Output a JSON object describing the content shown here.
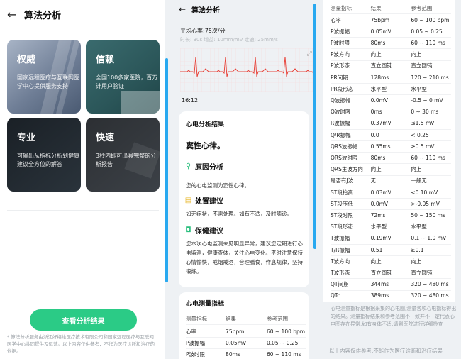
{
  "panel1": {
    "title": "算法分析",
    "cards": [
      {
        "title": "权威",
        "desc": "国家远程医疗与互联网医学中心提供服务支持"
      },
      {
        "title": "信赖",
        "desc": "全国100多家医院，百万计用户验证"
      },
      {
        "title": "专业",
        "desc": "可输出从指标分析到健康建议全方位的解答"
      },
      {
        "title": "快速",
        "desc": "3秒内即可出具完整的分析报告"
      }
    ],
    "cta": "查看分析结果",
    "disclaimer": "* 算法分析服务由浙江好络维医疗技术有限公司和国家远程医疗与互联网医学中心共同提供及运营。以上内容仅供参考，不作为医疗诊断和治疗的依据。"
  },
  "panel2": {
    "title": "算法分析",
    "avg_hr": "平均心率:75次/分",
    "params": "时长: 30s 增益: 10mm/mV 走速: 25mm/s",
    "time": "16:12",
    "result_title": "心电分析结果",
    "result": "窦性心律。",
    "cause_title": "原因分析",
    "cause_text": "您的心电监测为窦性心律。",
    "advice_title": "处置建议",
    "advice_text": "如无症状，不需处理。如有不适，及时随诊。",
    "care_title": "保健建议",
    "care_text": "您本次心电监测未见明显异常，建议您定期进行心电监测，健康查体，关注心电变化。平时注意保持心情愉快，戒烟戒酒，合理膳食，作息规律，坚持锻炼。",
    "metrics_title": "心电测量指标",
    "metrics_header": [
      "测量指标",
      "结果",
      "参考范围"
    ],
    "metrics_rows": [
      [
        "心率",
        "75bpm",
        "60 ~ 100 bpm"
      ],
      [
        "P波振幅",
        "0.05mV",
        "0.05 ~ 0.25"
      ],
      [
        "P波时限",
        "80ms",
        "60 ~ 110 ms"
      ]
    ]
  },
  "panel3": {
    "header": [
      "测量指标",
      "结果",
      "参考范围"
    ],
    "rows": [
      [
        "心率",
        "75bpm",
        "60 ~ 100 bpm"
      ],
      [
        "P波振幅",
        "0.05mV",
        "0.05 ~ 0.25"
      ],
      [
        "P波时限",
        "80ms",
        "60 ~ 110 ms"
      ],
      [
        "P波方向",
        "向上",
        "向上"
      ],
      [
        "P波形态",
        "直立圆钝",
        "直立圆钝"
      ],
      [
        "PR间期",
        "128ms",
        "120 ~ 210 ms"
      ],
      [
        "PR段形态",
        "水平型",
        "水平型"
      ],
      [
        "Q波振幅",
        "0.0mV",
        "-0.5 ~ 0 mV"
      ],
      [
        "Q波时限",
        "0ms",
        "0 ~ 30 ms"
      ],
      [
        "R波振幅",
        "0.37mV",
        "≤1.5 mV"
      ],
      [
        "Q/R振幅",
        "0.0",
        "< 0.25"
      ],
      [
        "QRS波振幅",
        "0.55ms",
        "≥0.5 mV"
      ],
      [
        "QRS波时限",
        "80ms",
        "60 ~ 110 ms"
      ],
      [
        "QRS主波方向",
        "向上",
        "向上"
      ],
      [
        "是否有J波",
        "无",
        "一般无"
      ],
      [
        "ST段抬高",
        "0.03mV",
        "<0.10 mV"
      ],
      [
        "ST段压低",
        "0.0mV",
        ">-0.05 mV"
      ],
      [
        "ST段时限",
        "72ms",
        "50 ~ 150 ms"
      ],
      [
        "ST段形态",
        "水平型",
        "水平型"
      ],
      [
        "T波振幅",
        "0.19mV",
        "0.1 ~ 1.0 mV"
      ],
      [
        "T/R振幅",
        "0.51",
        "≥0.1"
      ],
      [
        "T波方向",
        "向上",
        "向上"
      ],
      [
        "T波形态",
        "直立圆钝",
        "直立圆钝"
      ],
      [
        "QT间期",
        "344ms",
        "320 ~ 480 ms"
      ],
      [
        "QTc",
        "389ms",
        "320 ~ 480 ms"
      ]
    ],
    "note": "心电测量指标是根据采集的心电图,测量各项心电指标得出的结果。测量指标结果和参考范围不一致并不一定代表心电图存在异常,如有身体不适,请到医院进行详细检查",
    "footer": "以上内容仅供参考,不能作为医疗诊断和治疗结果"
  },
  "colors": {
    "accent": "#2bcb86",
    "scrollbar": "#29a9f0",
    "ecg_line": "#e8453c",
    "ecg_grid": "#f6dada"
  },
  "icons": [
    "back-arrow-icon",
    "search-icon",
    "note-icon",
    "shield-icon",
    "expand-icon"
  ]
}
